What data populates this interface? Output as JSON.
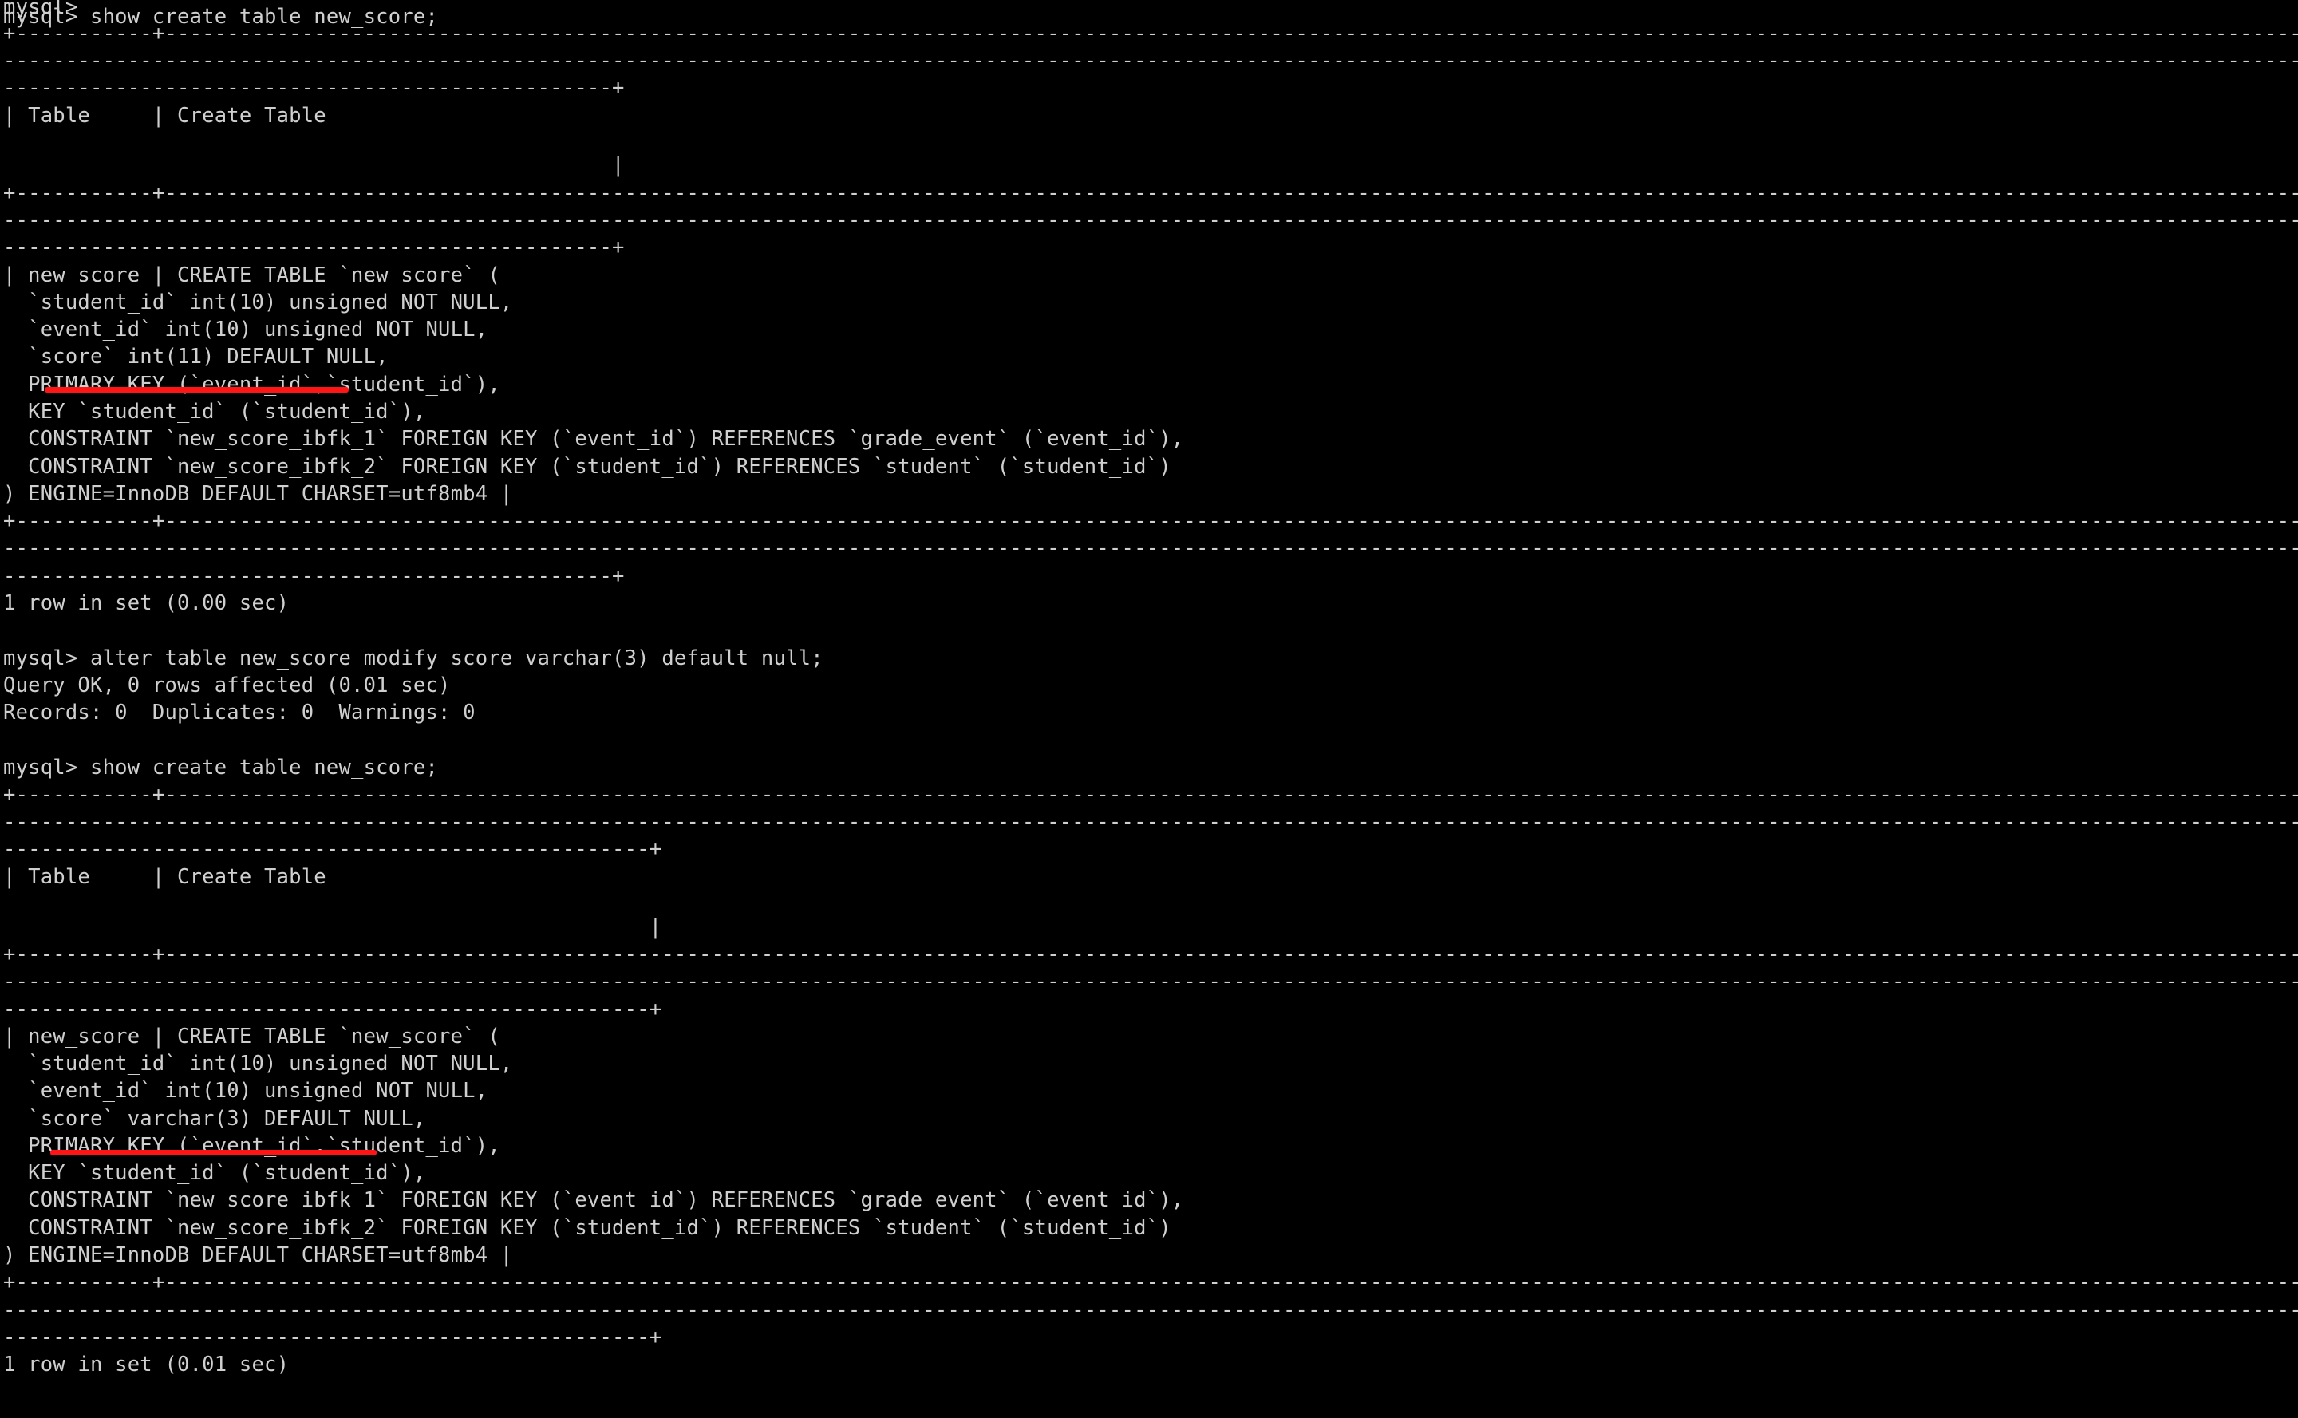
{
  "terminal": {
    "background_color": "#000000",
    "text_color": "#cfcfcf",
    "annotation_color": "#ff1515",
    "prompt": "mysql>",
    "lines": [
      {
        "id": "l0",
        "text": "mysql>"
      },
      {
        "id": "l1",
        "text": "mysql> show create table new_score;"
      },
      {
        "id": "l2",
        "text": "+-----------+----------------------------------------------------------------------------------------------------------------------------------------------------------------------------------"
      },
      {
        "id": "l3",
        "text": "-------------------------------------------------------------------------------------------------------------------------------------------------------------------------------------------"
      },
      {
        "id": "l4",
        "text": "-------------------------------------------------+"
      },
      {
        "id": "l5",
        "text": "| Table     | Create Table"
      },
      {
        "id": "l6",
        "text": ""
      },
      {
        "id": "l7",
        "text": "                                                 |"
      },
      {
        "id": "l8",
        "text": "+-----------+----------------------------------------------------------------------------------------------------------------------------------------------------------------------------------"
      },
      {
        "id": "l9",
        "text": "-------------------------------------------------------------------------------------------------------------------------------------------------------------------------------------------------"
      },
      {
        "id": "l10",
        "text": "-------------------------------------------------+"
      },
      {
        "id": "l11",
        "text": "| new_score | CREATE TABLE `new_score` ("
      },
      {
        "id": "l12",
        "text": "  `student_id` int(10) unsigned NOT NULL,"
      },
      {
        "id": "l13",
        "text": "  `event_id` int(10) unsigned NOT NULL,"
      },
      {
        "id": "l14",
        "text": "  `score` int(11) DEFAULT NULL,"
      },
      {
        "id": "l15",
        "text": "  PRIMARY KEY (`event_id`,`student_id`),"
      },
      {
        "id": "l16",
        "text": "  KEY `student_id` (`student_id`),"
      },
      {
        "id": "l17",
        "text": "  CONSTRAINT `new_score_ibfk_1` FOREIGN KEY (`event_id`) REFERENCES `grade_event` (`event_id`),"
      },
      {
        "id": "l18",
        "text": "  CONSTRAINT `new_score_ibfk_2` FOREIGN KEY (`student_id`) REFERENCES `student` (`student_id`)"
      },
      {
        "id": "l19",
        "text": ") ENGINE=InnoDB DEFAULT CHARSET=utf8mb4 |"
      },
      {
        "id": "l20",
        "text": "+-----------+----------------------------------------------------------------------------------------------------------------------------------------------------------------------------------"
      },
      {
        "id": "l21",
        "text": "-------------------------------------------------------------------------------------------------------------------------------------------------------------------------------------------------"
      },
      {
        "id": "l22",
        "text": "-------------------------------------------------+"
      },
      {
        "id": "l23",
        "text": "1 row in set (0.00 sec)"
      },
      {
        "id": "l24",
        "text": ""
      },
      {
        "id": "l25",
        "text": "mysql> alter table new_score modify score varchar(3) default null;"
      },
      {
        "id": "l26",
        "text": "Query OK, 0 rows affected (0.01 sec)"
      },
      {
        "id": "l27",
        "text": "Records: 0  Duplicates: 0  Warnings: 0"
      },
      {
        "id": "l28",
        "text": ""
      },
      {
        "id": "l29",
        "text": "mysql> show create table new_score;"
      },
      {
        "id": "l30",
        "text": "+-----------+-------------------------------------------------------------------------------------------------------------------------------------------------------------------------------------"
      },
      {
        "id": "l31",
        "text": "-------------------------------------------------------------------------------------------------------------------------------------------------------------------------------------------------"
      },
      {
        "id": "l32",
        "text": "----------------------------------------------------+"
      },
      {
        "id": "l33",
        "text": "| Table     | Create Table"
      },
      {
        "id": "l34",
        "text": ""
      },
      {
        "id": "l35",
        "text": "                                                    |"
      },
      {
        "id": "l36",
        "text": "+-----------+-------------------------------------------------------------------------------------------------------------------------------------------------------------------------------------"
      },
      {
        "id": "l37",
        "text": "-------------------------------------------------------------------------------------------------------------------------------------------------------------------------------------------------"
      },
      {
        "id": "l38",
        "text": "----------------------------------------------------+"
      },
      {
        "id": "l39",
        "text": "| new_score | CREATE TABLE `new_score` ("
      },
      {
        "id": "l40",
        "text": "  `student_id` int(10) unsigned NOT NULL,"
      },
      {
        "id": "l41",
        "text": "  `event_id` int(10) unsigned NOT NULL,"
      },
      {
        "id": "l42",
        "text": "  `score` varchar(3) DEFAULT NULL,"
      },
      {
        "id": "l43",
        "text": "  PRIMARY KEY (`event_id`,`student_id`),"
      },
      {
        "id": "l44",
        "text": "  KEY `student_id` (`student_id`),"
      },
      {
        "id": "l45",
        "text": "  CONSTRAINT `new_score_ibfk_1` FOREIGN KEY (`event_id`) REFERENCES `grade_event` (`event_id`),"
      },
      {
        "id": "l46",
        "text": "  CONSTRAINT `new_score_ibfk_2` FOREIGN KEY (`student_id`) REFERENCES `student` (`student_id`)"
      },
      {
        "id": "l47",
        "text": ") ENGINE=InnoDB DEFAULT CHARSET=utf8mb4 |"
      },
      {
        "id": "l48",
        "text": "+-----------+-------------------------------------------------------------------------------------------------------------------------------------------------------------------------------------"
      },
      {
        "id": "l49",
        "text": "-------------------------------------------------------------------------------------------------------------------------------------------------------------------------------------------------"
      },
      {
        "id": "l50",
        "text": "----------------------------------------------------+"
      },
      {
        "id": "l51",
        "text": "1 row in set (0.01 sec)"
      }
    ],
    "annotations": [
      {
        "id": "a0",
        "target": "`score` int(11) DEFAULT NULL,"
      },
      {
        "id": "a1",
        "target": "`score` varchar(3) DEFAULT NULL,"
      }
    ]
  }
}
